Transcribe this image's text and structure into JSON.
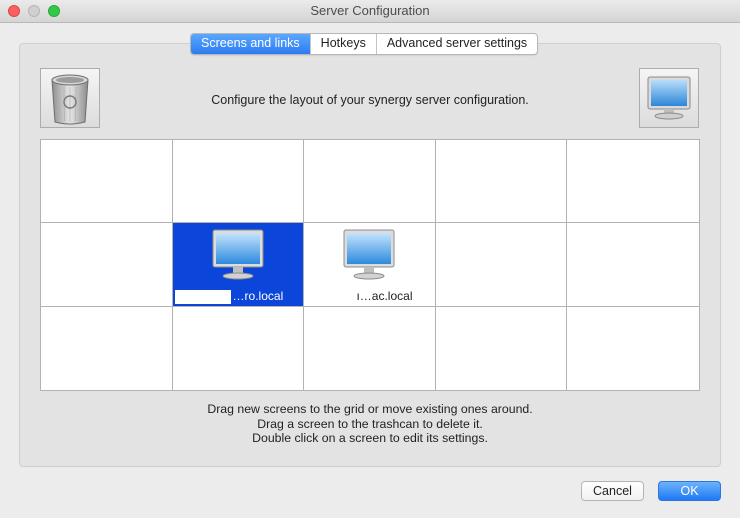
{
  "window": {
    "title": "Server Configuration"
  },
  "tabs": [
    {
      "label": "Screens and links",
      "active": true
    },
    {
      "label": "Hotkeys",
      "active": false
    },
    {
      "label": "Advanced server settings",
      "active": false
    }
  ],
  "instructions": {
    "top": "Configure the layout of your synergy server configuration.",
    "bottom": [
      "Drag new screens to the grid or move existing ones around.",
      "Drag a screen to the trashcan to delete it.",
      "Double click on a screen to edit its settings."
    ]
  },
  "icons": {
    "trash": "trash-can-icon",
    "new_screen": "monitor-icon"
  },
  "grid": {
    "rows": 3,
    "columns": 5,
    "screens": [
      {
        "row": 2,
        "column": 2,
        "label": "…ro.local",
        "selected": true
      },
      {
        "row": 2,
        "column": 3,
        "label": "ı…ac.local",
        "selected": false
      }
    ]
  },
  "buttons": {
    "cancel": "Cancel",
    "ok": "OK"
  },
  "colors": {
    "accent": "#2d7cf0",
    "selection": "#0b45d9"
  }
}
